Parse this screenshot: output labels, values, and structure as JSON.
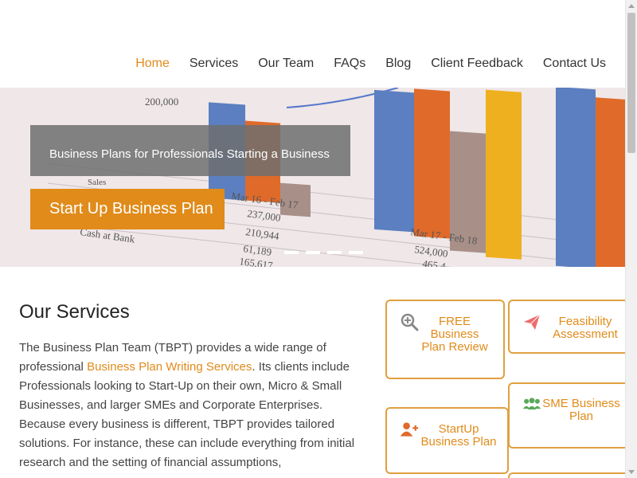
{
  "nav": {
    "items": [
      {
        "label": "Home",
        "active": true
      },
      {
        "label": "Services",
        "active": false
      },
      {
        "label": "Our Team",
        "active": false
      },
      {
        "label": "FAQs",
        "active": false
      },
      {
        "label": "Blog",
        "active": false
      },
      {
        "label": "Client Feedback",
        "active": false
      },
      {
        "label": "Contact Us",
        "active": false
      }
    ]
  },
  "hero": {
    "caption": "Business Plans for Professionals Starting a Business",
    "cta_label": "Start Up Business Plan",
    "slide_count": 4,
    "background_text": {
      "t1": "200,000",
      "t2": "Sales",
      "t3": "Mar 16 - Feb 17",
      "t4": "237,000",
      "t5": "210,944",
      "t6": "61,189",
      "t7": "165,617",
      "t8": "Cash at Bank",
      "t9": "Mar 17 - Feb 18",
      "t10": "524,000",
      "t11": "465,4"
    }
  },
  "services": {
    "title": "Our Services",
    "intro_before_link": "The Business Plan Team (TBPT) provides a wide range of professional ",
    "link_text": "Business Plan Writing Services",
    "intro_after_link": ". Its clients include Professionals looking to Start-Up on their own, Micro & Small Businesses, and larger SMEs and Corporate Enterprises. Because every business is different, TBPT provides tailored solutions. For instance, these can include everything from initial research and the setting of financial assumptions,",
    "cards": [
      {
        "label": "FREE Business Plan Review",
        "icon": "magnifier-plus-icon"
      },
      {
        "label": "Feasibility Assessment",
        "icon": "paper-plane-icon"
      },
      {
        "label": "SME Business Plan",
        "icon": "users-group-icon"
      },
      {
        "label": "StartUp Business Plan",
        "icon": "user-plus-icon"
      }
    ]
  },
  "colors": {
    "accent": "#e08b1a",
    "card_border": "#e0a040",
    "caption_bg": "#6e6e6e"
  }
}
